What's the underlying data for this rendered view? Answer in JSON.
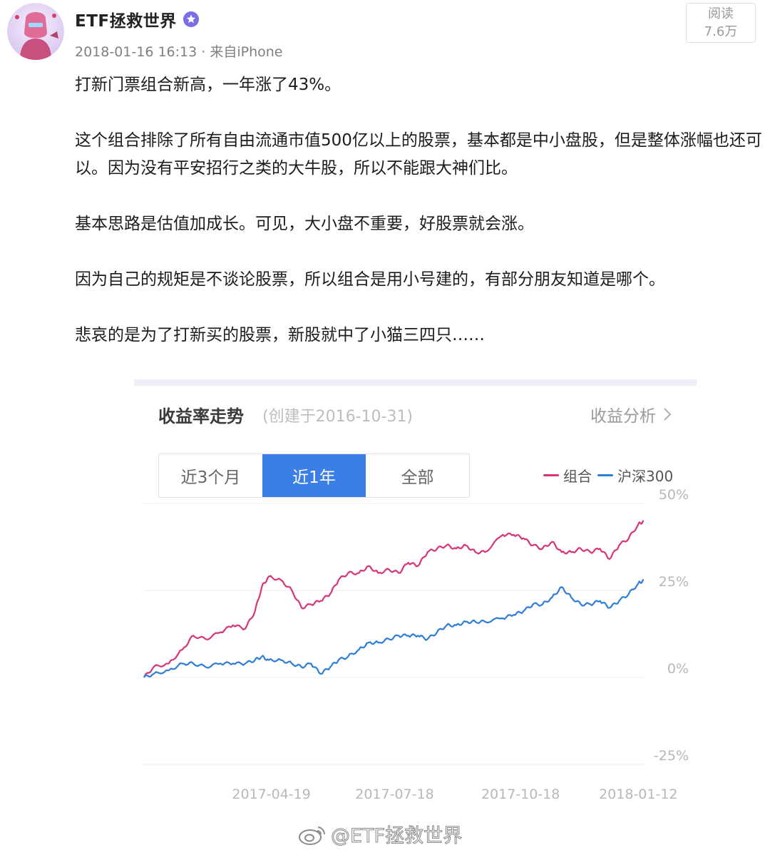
{
  "post": {
    "username": "ETF拯救世界",
    "meta": "2018-01-16 16:13 · 来自iPhone",
    "read_label": "阅读",
    "read_count": "7.6万",
    "paragraphs": [
      "打新门票组合新高，一年涨了43%。",
      "这个组合排除了所有自由流通市值500亿以上的股票，基本都是中小盘股，但是整体涨幅也还可以。因为没有平安招行之类的大牛股，所以不能跟大神们比。",
      "基本思路是估值加成长。可见，大小盘不重要，好股票就会涨。",
      "因为自己的规矩是不谈论股票，所以组合是用小号建的，有部分朋友知道是哪个。",
      "悲哀的是为了打新买的股票，新股就中了小猫三四只……"
    ]
  },
  "card": {
    "title": "收益率走势",
    "subtitle": "(创建于2016-10-31)",
    "link": "收益分析",
    "tabs": [
      {
        "label": "近3个月",
        "active": false
      },
      {
        "label": "近1年",
        "active": true
      },
      {
        "label": "全部",
        "active": false
      }
    ]
  },
  "watermark": "@ETF拯救世界",
  "colors": {
    "portfolio": "#d8347a",
    "index": "#2e7ed8",
    "active_tab": "#3b7ee6"
  },
  "icons": {
    "verified": "verified-badge-icon",
    "chevron": "chevron-right-icon",
    "weibo": "weibo-logo-icon"
  },
  "chart_data": {
    "type": "line",
    "xlabel": "",
    "ylabel": "",
    "ylim": [
      -25,
      50
    ],
    "y_ticks": [
      50,
      25,
      0,
      -25
    ],
    "y_tick_labels": [
      "50%",
      "25%",
      "0%",
      "-25%"
    ],
    "x_range": [
      "2017-01-16",
      "2018-01-16"
    ],
    "x_tick_labels": [
      "2017-04-19",
      "2017-07-18",
      "2017-10-18",
      "2018-01-12"
    ],
    "grid": true,
    "legend": "top-right",
    "series": [
      {
        "name": "组合",
        "color": "#d8347a",
        "points": [
          [
            "2017-01-16",
            0
          ],
          [
            "2017-01-23",
            3
          ],
          [
            "2017-02-03",
            4
          ],
          [
            "2017-02-13",
            8
          ],
          [
            "2017-02-21",
            12
          ],
          [
            "2017-03-02",
            11
          ],
          [
            "2017-03-13",
            13
          ],
          [
            "2017-03-22",
            15
          ],
          [
            "2017-03-31",
            14
          ],
          [
            "2017-04-07",
            19
          ],
          [
            "2017-04-12",
            26
          ],
          [
            "2017-04-17",
            29
          ],
          [
            "2017-04-26",
            28
          ],
          [
            "2017-05-04",
            25
          ],
          [
            "2017-05-11",
            20
          ],
          [
            "2017-05-18",
            21
          ],
          [
            "2017-05-25",
            22
          ],
          [
            "2017-06-01",
            24
          ],
          [
            "2017-06-07",
            28
          ],
          [
            "2017-06-14",
            30
          ],
          [
            "2017-06-22",
            30
          ],
          [
            "2017-06-29",
            32
          ],
          [
            "2017-07-06",
            30
          ],
          [
            "2017-07-14",
            31
          ],
          [
            "2017-07-21",
            30
          ],
          [
            "2017-07-28",
            33
          ],
          [
            "2017-08-04",
            32
          ],
          [
            "2017-08-11",
            36
          ],
          [
            "2017-08-18",
            37
          ],
          [
            "2017-08-25",
            38
          ],
          [
            "2017-09-01",
            37
          ],
          [
            "2017-09-08",
            38
          ],
          [
            "2017-09-15",
            36
          ],
          [
            "2017-09-22",
            36
          ],
          [
            "2017-10-05",
            41
          ],
          [
            "2017-10-13",
            41
          ],
          [
            "2017-10-20",
            40
          ],
          [
            "2017-10-27",
            38
          ],
          [
            "2017-11-03",
            37
          ],
          [
            "2017-11-10",
            39
          ],
          [
            "2017-11-17",
            36
          ],
          [
            "2017-11-24",
            36
          ],
          [
            "2017-12-01",
            37
          ],
          [
            "2017-12-08",
            36
          ],
          [
            "2017-12-15",
            37
          ],
          [
            "2017-12-22",
            34
          ],
          [
            "2017-12-29",
            38
          ],
          [
            "2018-01-05",
            40
          ],
          [
            "2018-01-12",
            44
          ],
          [
            "2018-01-16",
            45
          ]
        ]
      },
      {
        "name": "沪深300",
        "color": "#2e7ed8",
        "points": [
          [
            "2017-01-16",
            0
          ],
          [
            "2017-01-23",
            1
          ],
          [
            "2017-02-03",
            2
          ],
          [
            "2017-02-13",
            4
          ],
          [
            "2017-02-21",
            4
          ],
          [
            "2017-03-02",
            3
          ],
          [
            "2017-03-13",
            4
          ],
          [
            "2017-03-22",
            4
          ],
          [
            "2017-03-31",
            4
          ],
          [
            "2017-04-07",
            5
          ],
          [
            "2017-04-12",
            6
          ],
          [
            "2017-04-17",
            5
          ],
          [
            "2017-04-26",
            5
          ],
          [
            "2017-05-04",
            4
          ],
          [
            "2017-05-11",
            3
          ],
          [
            "2017-05-18",
            4
          ],
          [
            "2017-05-25",
            1
          ],
          [
            "2017-06-01",
            3
          ],
          [
            "2017-06-07",
            5
          ],
          [
            "2017-06-14",
            6
          ],
          [
            "2017-06-22",
            8
          ],
          [
            "2017-06-29",
            10
          ],
          [
            "2017-07-06",
            10
          ],
          [
            "2017-07-14",
            11
          ],
          [
            "2017-07-21",
            12
          ],
          [
            "2017-07-28",
            12
          ],
          [
            "2017-08-04",
            12
          ],
          [
            "2017-08-11",
            11
          ],
          [
            "2017-08-18",
            13
          ],
          [
            "2017-08-25",
            15
          ],
          [
            "2017-09-01",
            15
          ],
          [
            "2017-09-08",
            16
          ],
          [
            "2017-09-15",
            16
          ],
          [
            "2017-09-22",
            16
          ],
          [
            "2017-10-05",
            17
          ],
          [
            "2017-10-13",
            18
          ],
          [
            "2017-10-20",
            19
          ],
          [
            "2017-10-27",
            21
          ],
          [
            "2017-11-03",
            21
          ],
          [
            "2017-11-10",
            23
          ],
          [
            "2017-11-17",
            26
          ],
          [
            "2017-11-24",
            23
          ],
          [
            "2017-12-01",
            21
          ],
          [
            "2017-12-08",
            21
          ],
          [
            "2017-12-15",
            22
          ],
          [
            "2017-12-22",
            20
          ],
          [
            "2017-12-29",
            22
          ],
          [
            "2018-01-05",
            24
          ],
          [
            "2018-01-12",
            27
          ],
          [
            "2018-01-16",
            28
          ]
        ]
      }
    ]
  }
}
